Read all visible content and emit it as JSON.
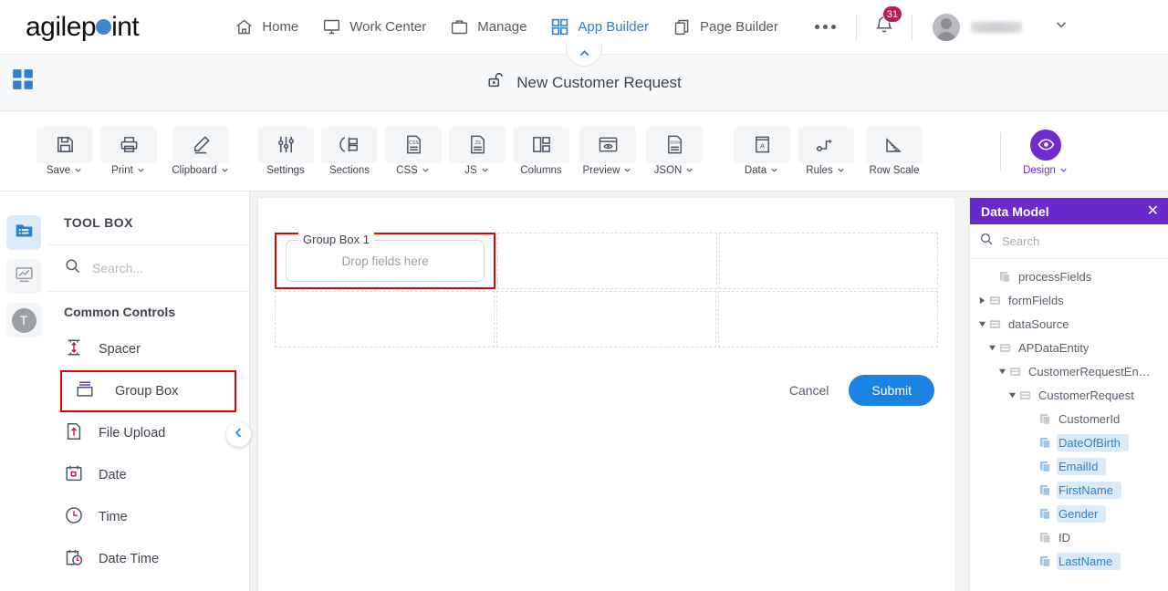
{
  "brand": {
    "name_part1": "agilep",
    "name_part2": "int",
    "accent": "#3d87cf"
  },
  "topnav": {
    "items": [
      {
        "label": "Home",
        "icon": "home-icon",
        "active": false
      },
      {
        "label": "Work Center",
        "icon": "monitor-icon",
        "active": false
      },
      {
        "label": "Manage",
        "icon": "briefcase-icon",
        "active": false
      },
      {
        "label": "App Builder",
        "icon": "grid-icon",
        "active": true
      },
      {
        "label": "Page Builder",
        "icon": "pages-icon",
        "active": false
      }
    ],
    "more_label": "...",
    "notification_count": "31",
    "user_name": ""
  },
  "titlebar": {
    "title": "New Customer Request",
    "icon": "unlock-icon"
  },
  "ribbon": {
    "items": [
      {
        "label": "Save",
        "icon": "save-icon",
        "caret": true
      },
      {
        "label": "Print",
        "icon": "print-icon",
        "caret": true
      },
      {
        "label": "Clipboard",
        "icon": "pencil-icon",
        "caret": true
      },
      {
        "label": "Settings",
        "icon": "sliders-icon",
        "caret": false
      },
      {
        "label": "Sections",
        "icon": "sections-icon",
        "caret": false
      },
      {
        "label": "CSS",
        "icon": "css-file-icon",
        "caret": true
      },
      {
        "label": "JS",
        "icon": "js-file-icon",
        "caret": true
      },
      {
        "label": "Columns",
        "icon": "columns-icon",
        "caret": false
      },
      {
        "label": "Preview",
        "icon": "eye-window-icon",
        "caret": true
      },
      {
        "label": "JSON",
        "icon": "json-file-icon",
        "caret": true
      },
      {
        "label": "Data",
        "icon": "data-book-icon",
        "caret": true
      },
      {
        "label": "Rules",
        "icon": "rules-flow-icon",
        "caret": true
      },
      {
        "label": "Row Scale",
        "icon": "ruler-icon",
        "caret": false
      }
    ],
    "design": {
      "label": "Design",
      "icon": "eye-icon",
      "caret": true,
      "color": "#7129d0"
    }
  },
  "rail": {
    "items": [
      {
        "icon": "folder-list-icon",
        "active": true
      },
      {
        "icon": "chart-icon",
        "active": false
      },
      {
        "icon": "text-t-icon",
        "active": false
      }
    ]
  },
  "toolbox": {
    "title": "TOOL BOX",
    "search_placeholder": "Search...",
    "search_value": "",
    "section_label": "Common Controls",
    "items": [
      {
        "label": "Spacer",
        "icon": "spacer-icon",
        "selected": false
      },
      {
        "label": "Group Box",
        "icon": "group-box-icon",
        "selected": true
      },
      {
        "label": "File Upload",
        "icon": "file-upload-icon",
        "selected": false
      },
      {
        "label": "Date",
        "icon": "date-icon",
        "selected": false
      },
      {
        "label": "Time",
        "icon": "time-icon",
        "selected": false
      },
      {
        "label": "Date Time",
        "icon": "date-time-icon",
        "selected": false
      }
    ],
    "collapse_icon": "chevron-left-icon"
  },
  "canvas": {
    "group_box": {
      "legend": "Group Box 1",
      "placeholder": "Drop fields here",
      "highlighted": true
    },
    "cancel_label": "Cancel",
    "submit_label": "Submit",
    "submit_color": "#1a82e2"
  },
  "data_model": {
    "title": "Data Model",
    "header_color": "#6a29cf",
    "close_icon": "close-icon",
    "search_placeholder": "Search",
    "search_value": "",
    "tree": [
      {
        "label": "processFields",
        "indent": 1,
        "arrow": "none",
        "icon": "field-icon",
        "selected": false
      },
      {
        "label": "formFields",
        "indent": 0,
        "arrow": "right",
        "icon": "folder-icon",
        "selected": false
      },
      {
        "label": "dataSource",
        "indent": 0,
        "arrow": "down",
        "icon": "folder-icon",
        "selected": false
      },
      {
        "label": "APDataEntity",
        "indent": 1,
        "arrow": "down",
        "icon": "folder-icon",
        "selected": false
      },
      {
        "label": "CustomerRequestEn…",
        "indent": 2,
        "arrow": "down",
        "icon": "folder-icon",
        "selected": false
      },
      {
        "label": "CustomerRequest",
        "indent": 3,
        "arrow": "down",
        "icon": "folder-icon",
        "selected": false
      },
      {
        "label": "CustomerId",
        "indent": 5,
        "arrow": "none",
        "icon": "field-icon",
        "selected": false
      },
      {
        "label": "DateOfBirth",
        "indent": 5,
        "arrow": "none",
        "icon": "field-icon",
        "selected": true
      },
      {
        "label": "EmailId",
        "indent": 5,
        "arrow": "none",
        "icon": "field-icon",
        "selected": true
      },
      {
        "label": "FirstName",
        "indent": 5,
        "arrow": "none",
        "icon": "field-icon",
        "selected": true
      },
      {
        "label": "Gender",
        "indent": 5,
        "arrow": "none",
        "icon": "field-icon",
        "selected": true
      },
      {
        "label": "ID",
        "indent": 5,
        "arrow": "none",
        "icon": "field-icon",
        "selected": false
      },
      {
        "label": "LastName",
        "indent": 5,
        "arrow": "none",
        "icon": "field-icon",
        "selected": true
      }
    ]
  }
}
